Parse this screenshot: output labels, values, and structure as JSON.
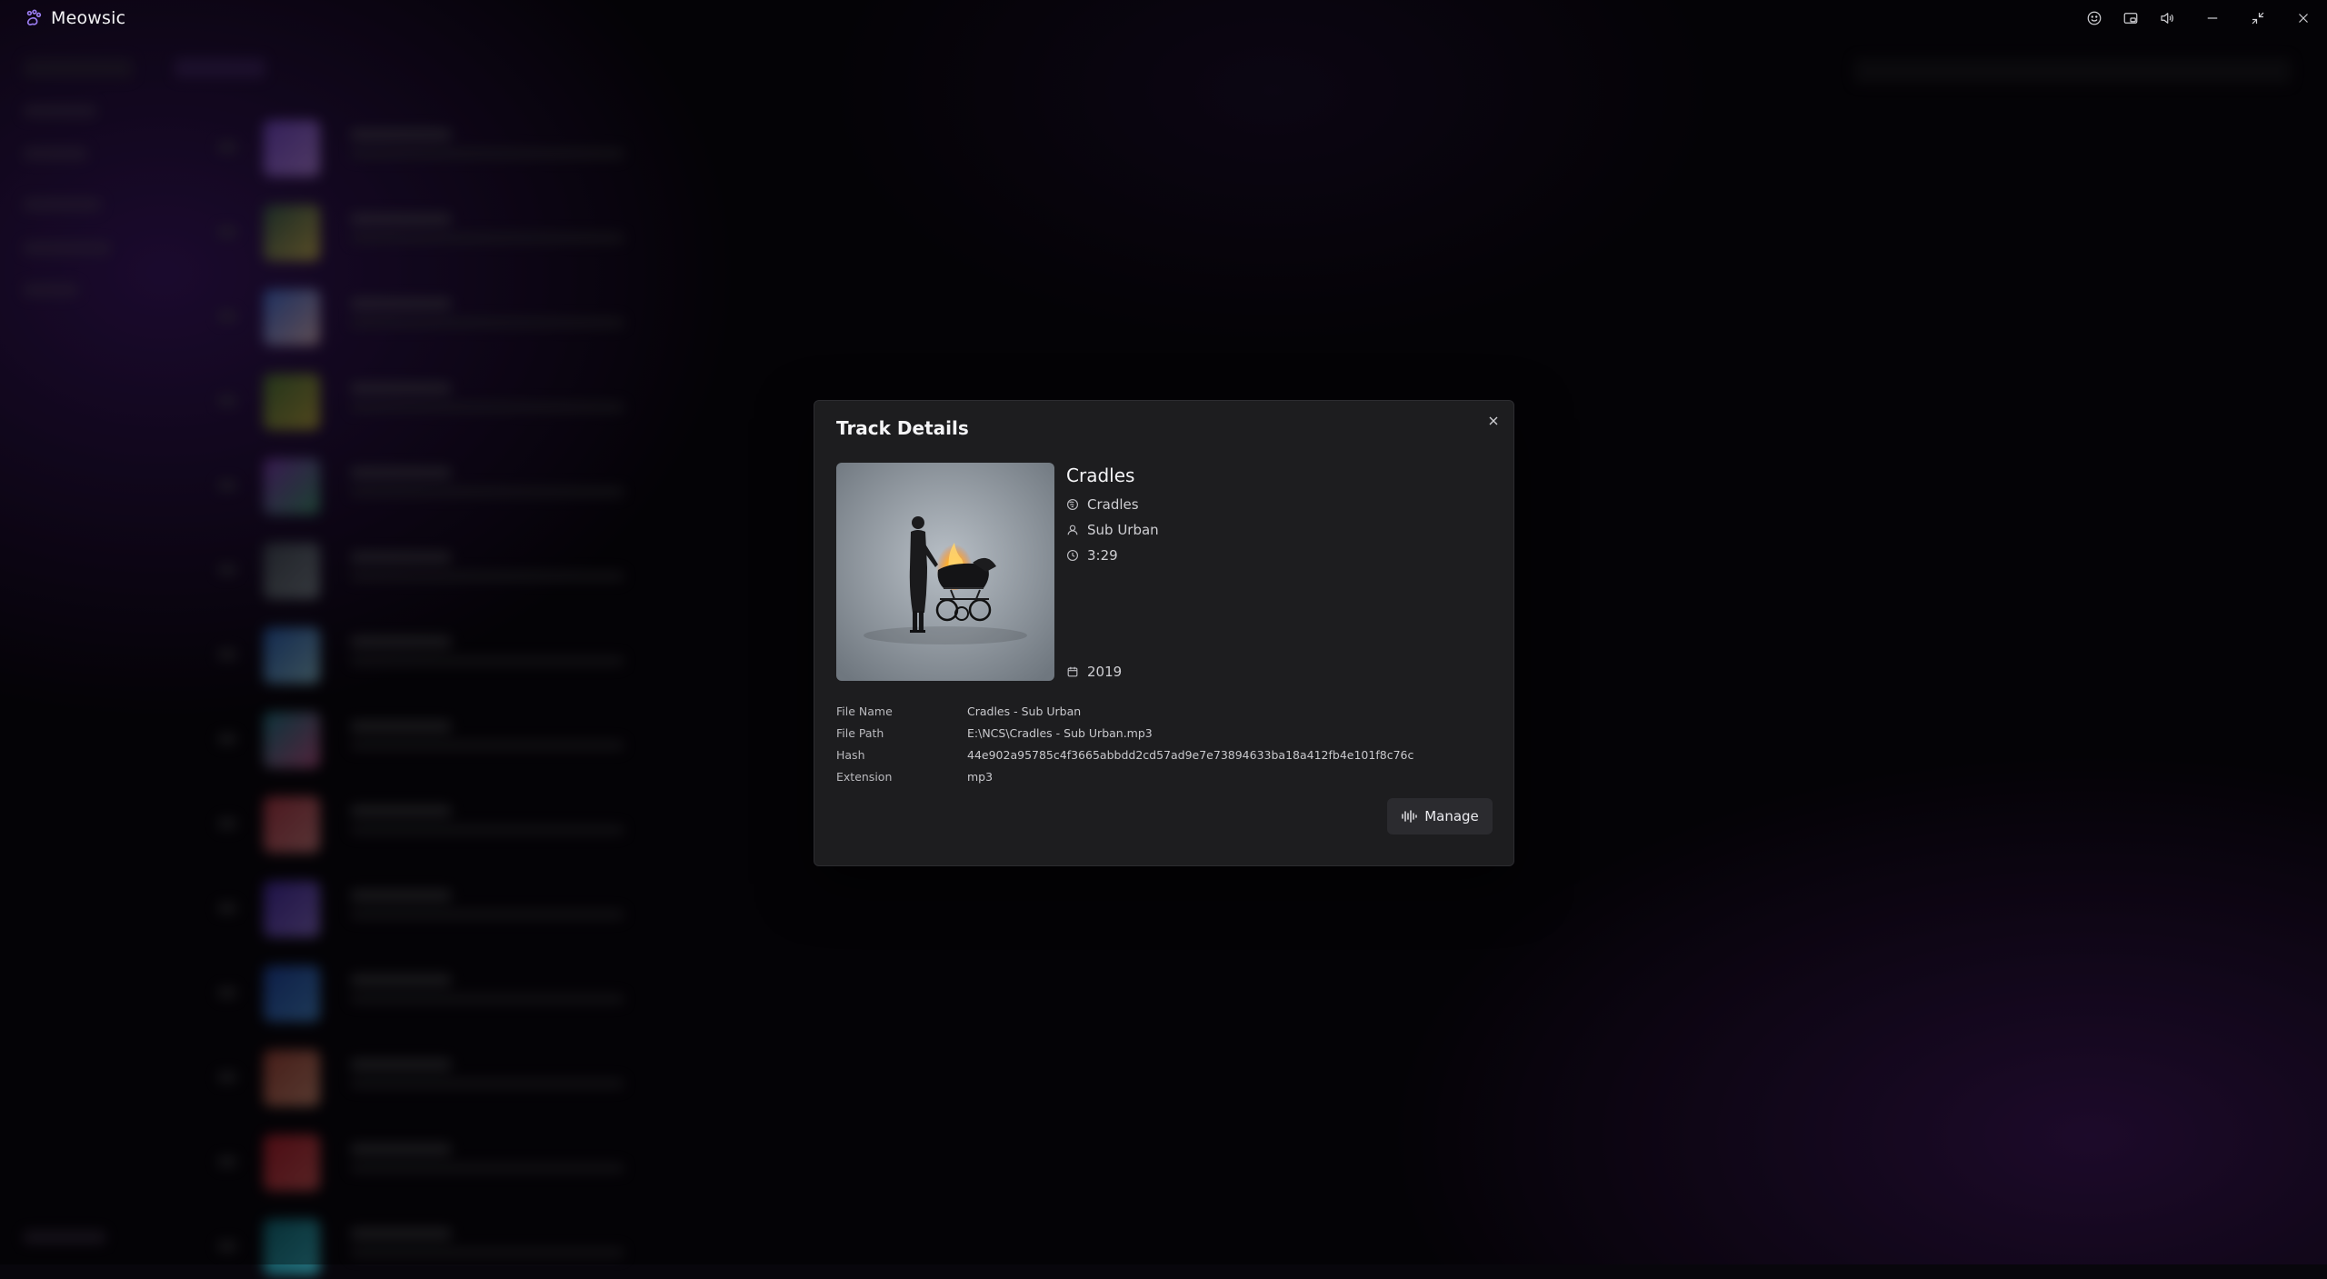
{
  "app": {
    "title": "Meowsic"
  },
  "window_controls": [
    "emoji-icon",
    "miniplayer-icon",
    "volume-icon",
    "minimize-icon",
    "restore-icon",
    "close-icon"
  ],
  "modal": {
    "title": "Track Details",
    "track": {
      "name": "Cradles",
      "album": "Cradles",
      "artist": "Sub Urban",
      "duration": "3:29",
      "year": "2019"
    },
    "details": [
      {
        "label": "File Name",
        "value": "Cradles - Sub Urban"
      },
      {
        "label": "File Path",
        "value": "E:\\NCS\\Cradles - Sub Urban.mp3"
      },
      {
        "label": "Hash",
        "value": "44e902a95785c4f3665abbdd2cd57ad9e7e73894633ba18a412fb4e101f8c76c"
      },
      {
        "label": "Extension",
        "value": "mp3"
      }
    ],
    "manage_label": "Manage"
  },
  "colors": {
    "modal_bg": "#1d1d1f",
    "accent": "#8a5cf6",
    "button_bg": "#2b2b2f"
  }
}
